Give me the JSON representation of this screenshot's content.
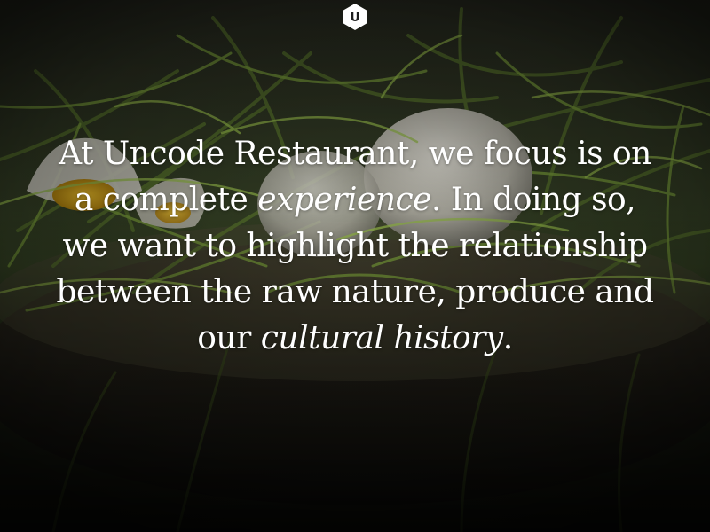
{
  "logo": {
    "letter": "U",
    "icon": "hexagon-logo-icon"
  },
  "quote": {
    "part1": "At Uncode Restaurant, we focus is on a complete ",
    "emphasis1": "experience",
    "part2": ". In doing so, we want to highlight the relationship between the raw nature, produce and our ",
    "emphasis2": "cultural history",
    "part3": "."
  },
  "background": {
    "description_icon": "eggs-in-grass-nest-photo"
  },
  "colors": {
    "text": "#ffffff",
    "logo_fill": "#ffffff",
    "overlay": "#000000"
  }
}
